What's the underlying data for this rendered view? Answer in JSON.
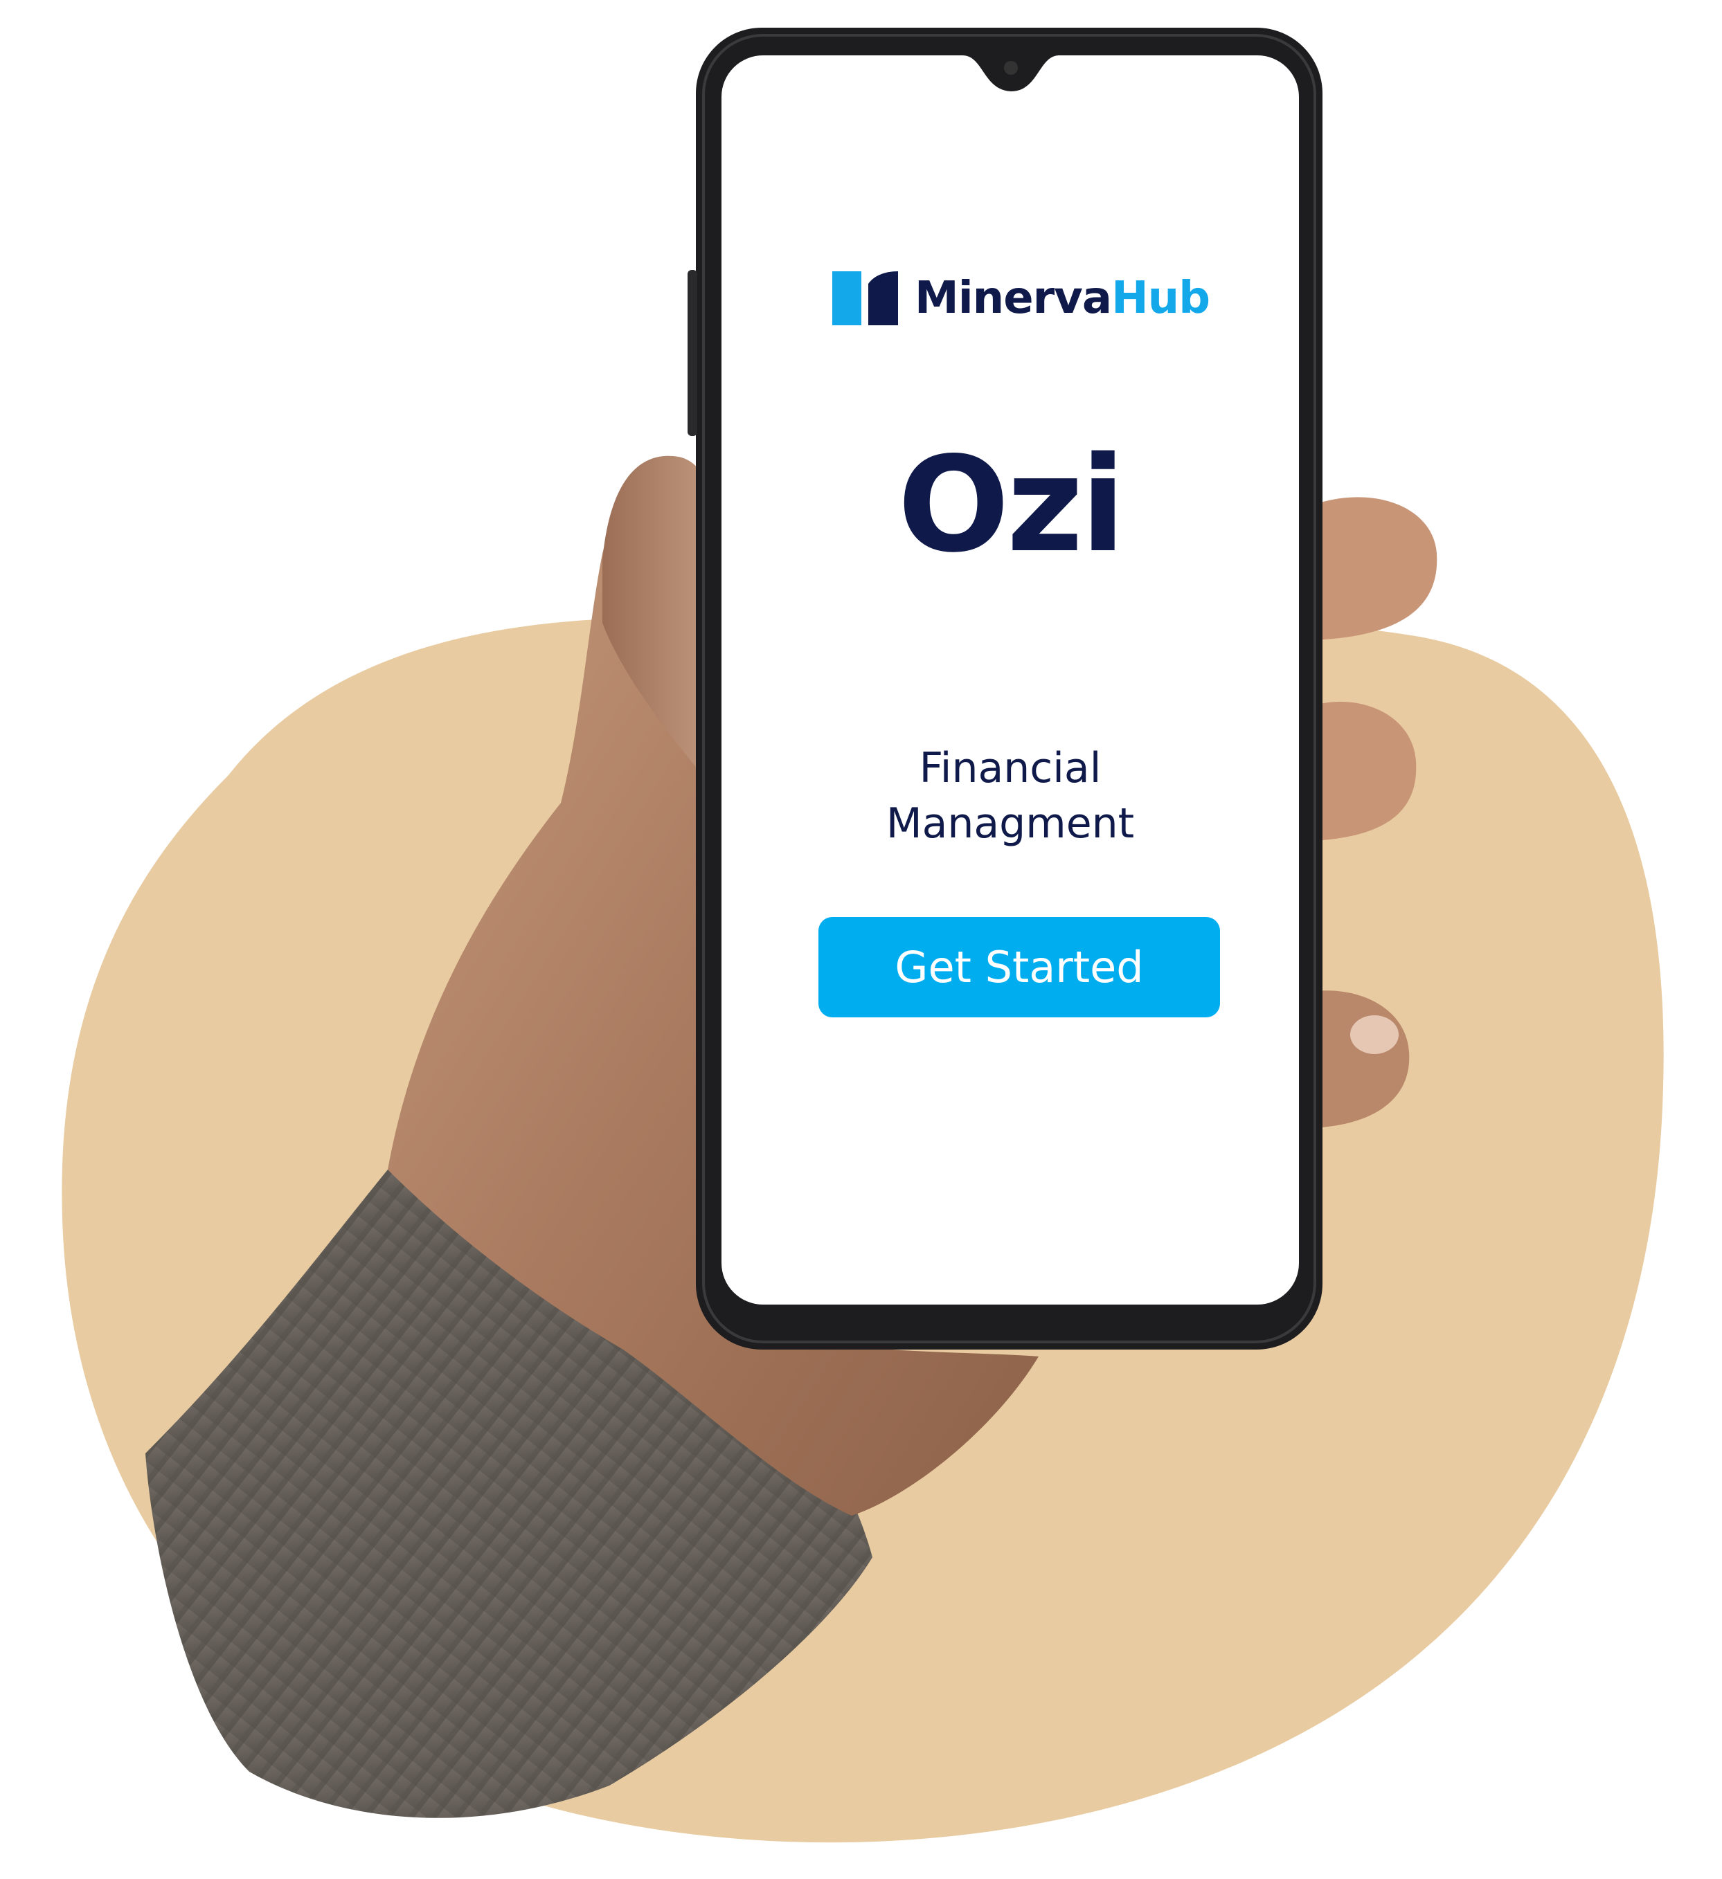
{
  "brand": {
    "name_part1": "Minerva",
    "name_part2": "Hub",
    "colors": {
      "navy": "#0f1a4a",
      "accent": "#12a8ea",
      "button": "#00aeef"
    },
    "logo_icon": "minervahub-logo-icon"
  },
  "app": {
    "title": "Ozi",
    "tagline_line1": "Financial",
    "tagline_line2": "Managment"
  },
  "cta": {
    "label": "Get Started"
  },
  "background": {
    "blob_color": "#e8cba0"
  }
}
